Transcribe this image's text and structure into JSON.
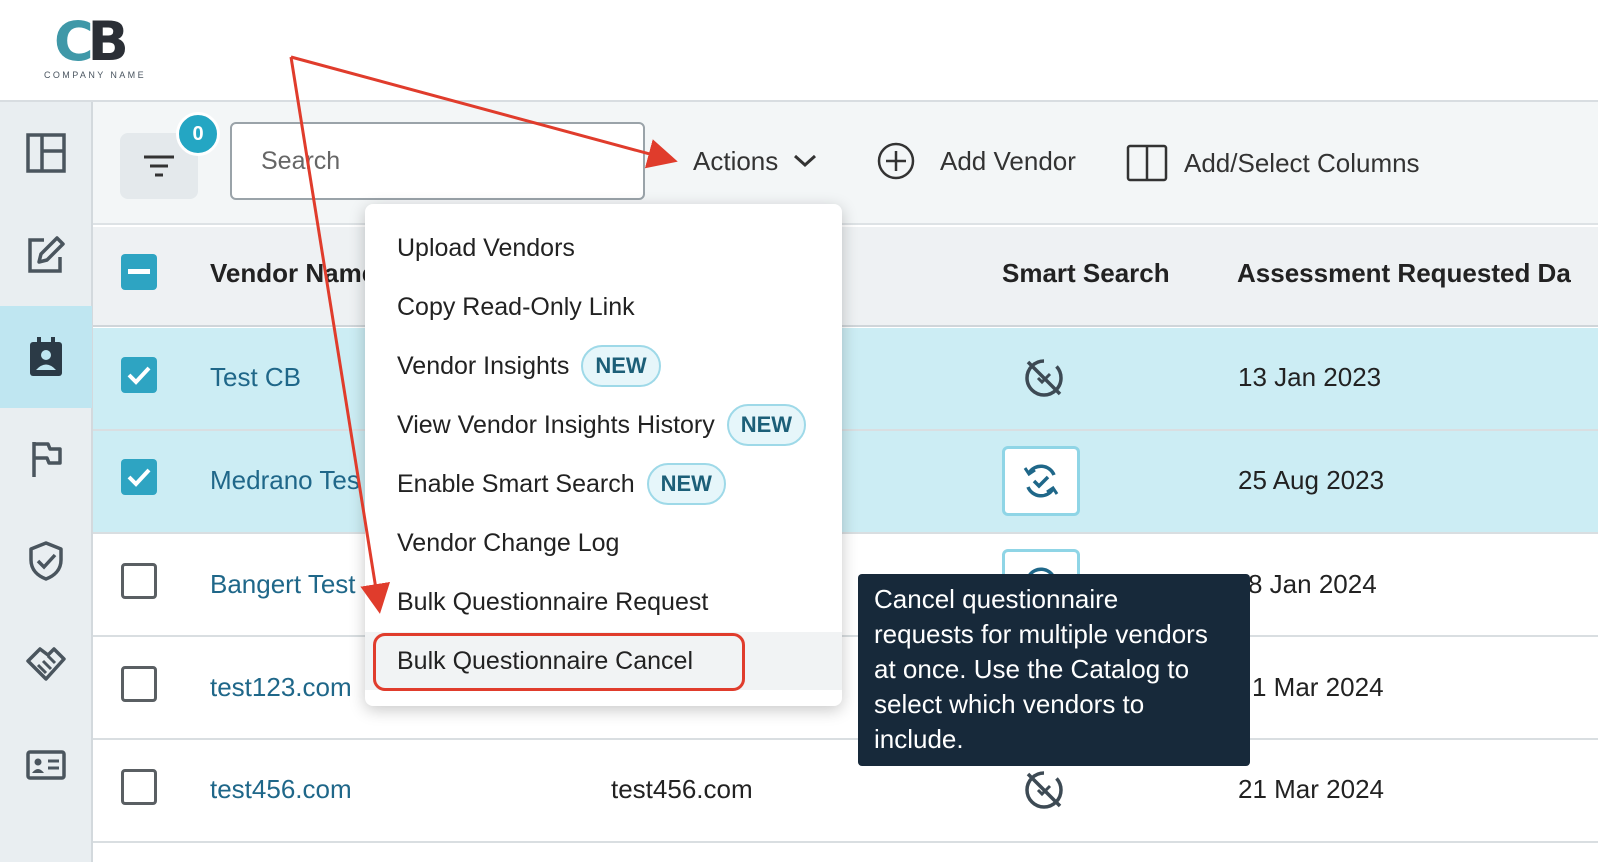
{
  "logo": {
    "mark_c": "C",
    "mark_b": "B",
    "subtitle": "COMPANY NAME"
  },
  "sidebar": {
    "items": [
      {
        "name": "dashboard",
        "icon": "layout-panels-icon",
        "active": false
      },
      {
        "name": "edit",
        "icon": "edit-square-icon",
        "active": false
      },
      {
        "name": "assessments",
        "icon": "contact-clipboard-icon",
        "active": true
      },
      {
        "name": "flags",
        "icon": "flag-icon",
        "active": false
      },
      {
        "name": "security",
        "icon": "shield-check-icon",
        "active": false
      },
      {
        "name": "partners",
        "icon": "handshake-icon",
        "active": false
      },
      {
        "name": "contacts",
        "icon": "id-card-icon",
        "active": false
      }
    ]
  },
  "toolbar": {
    "filter_count": "0",
    "search_placeholder": "Search",
    "actions_label": "Actions",
    "add_vendor_label": "Add Vendor",
    "add_select_columns_label": "Add/Select Columns"
  },
  "table": {
    "headers": {
      "vendor_name": "Vendor Name",
      "smart_search": "Smart Search",
      "assessment_requested": "Assessment Requested Da"
    },
    "rows": [
      {
        "vendor": "Test CB",
        "domain": "",
        "smart_search": "disabled",
        "date": "13 Jan 2023",
        "selected": true
      },
      {
        "vendor": "Medrano Tes",
        "domain": "",
        "smart_search": "enabled",
        "date": "25 Aug 2023",
        "selected": true
      },
      {
        "vendor": "Bangert Test",
        "domain": "",
        "smart_search": "enabled",
        "date": "8 Jan 2024",
        "selected": false
      },
      {
        "vendor": "test123.com",
        "domain": "",
        "smart_search": "disabled",
        "date": "1 Mar 2024",
        "selected": false
      },
      {
        "vendor": "test456.com",
        "domain": "test456.com",
        "smart_search": "disabled",
        "date": "21 Mar 2024",
        "selected": false
      }
    ]
  },
  "actions_menu": {
    "items": [
      {
        "label": "Upload Vendors",
        "badge": ""
      },
      {
        "label": "Copy Read-Only Link",
        "badge": ""
      },
      {
        "label": "Vendor Insights",
        "badge": "NEW"
      },
      {
        "label": "View Vendor Insights History",
        "badge": "NEW"
      },
      {
        "label": "Enable Smart Search",
        "badge": "NEW"
      },
      {
        "label": "Vendor Change Log",
        "badge": ""
      },
      {
        "label": "Bulk Questionnaire Request",
        "badge": ""
      },
      {
        "label": "Bulk Questionnaire Cancel",
        "badge": ""
      }
    ],
    "highlighted": "Bulk Questionnaire Cancel"
  },
  "tooltip": {
    "lines": [
      "Cancel questionnaire",
      "requests for multiple vendors",
      "at once. Use the Catalog to",
      "select which vendors to",
      "include."
    ]
  },
  "colors": {
    "accent": "#2ea4c2",
    "selected_row": "#ccedf4",
    "link": "#1f6789",
    "annotation": "#e03c2c",
    "tooltip_bg": "#17293a"
  }
}
